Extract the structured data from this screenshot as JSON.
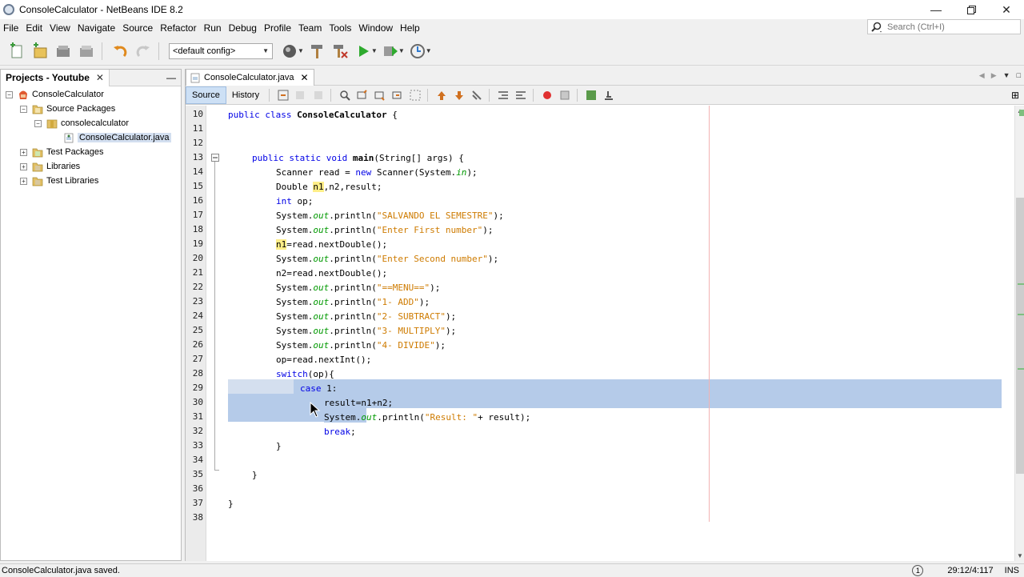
{
  "window": {
    "title": "ConsoleCalculator - NetBeans IDE 8.2",
    "controls": [
      "minimize",
      "restore",
      "close"
    ]
  },
  "menu": [
    "File",
    "Edit",
    "View",
    "Navigate",
    "Source",
    "Refactor",
    "Run",
    "Debug",
    "Profile",
    "Team",
    "Tools",
    "Window",
    "Help"
  ],
  "search": {
    "placeholder": "Search (Ctrl+I)"
  },
  "toolbar": {
    "config_value": "<default config>",
    "icons": [
      "new-file-icon",
      "new-project-icon",
      "open-project-icon",
      "close-project-icon",
      "undo-icon",
      "redo-icon",
      "globe-icon",
      "hammer-icon",
      "clean-build-icon",
      "run-icon",
      "debug-icon",
      "profile-icon"
    ]
  },
  "projects_panel": {
    "tab_label": "Projects - Youtube",
    "tree": [
      {
        "label": "ConsoleCalculator",
        "icon": "project-icon",
        "toggle": "−",
        "level": 0
      },
      {
        "label": "Source Packages",
        "icon": "folder-icon",
        "toggle": "−",
        "level": 1
      },
      {
        "label": "consolecalculator",
        "icon": "package-icon",
        "toggle": "−",
        "level": 2
      },
      {
        "label": "ConsoleCalculator.java",
        "icon": "java-file-icon",
        "toggle": "",
        "level": 3
      },
      {
        "label": "Test Packages",
        "icon": "folder-icon",
        "toggle": "+",
        "level": 1
      },
      {
        "label": "Libraries",
        "icon": "folder-icon",
        "toggle": "+",
        "level": 1
      },
      {
        "label": "Test Libraries",
        "icon": "folder-icon",
        "toggle": "+",
        "level": 1
      }
    ]
  },
  "editor": {
    "file_tab": "ConsoleCalculator.java",
    "modes": [
      "Source",
      "History"
    ],
    "active_mode": "Source",
    "line_numbers": [
      "10",
      "11",
      "12",
      "13",
      "14",
      "15",
      "16",
      "17",
      "18",
      "19",
      "20",
      "21",
      "22",
      "23",
      "24",
      "25",
      "26",
      "27",
      "28",
      "29",
      "30",
      "31",
      "32",
      "33",
      "34",
      "35",
      "36",
      "37",
      "38"
    ],
    "code": {
      "l10": {
        "kw": "public class ",
        "name": "ConsoleCalculator",
        "rest": " {"
      },
      "l13": {
        "kw": "public static void ",
        "name": "main",
        "rest": "(String[] args) {"
      },
      "l14": {
        "a": "Scanner read = ",
        "kw": "new",
        "b": " Scanner(System.",
        "fld": "in",
        "c": ");"
      },
      "l15": {
        "a": "Double ",
        "var": "n1",
        "b": ",n2,result;"
      },
      "l16": {
        "kw": "int",
        "a": " op;"
      },
      "l17": {
        "a": "System.",
        "fld": "out",
        "b": ".println(",
        "str": "\"SALVANDO EL SEMESTRE\"",
        "c": ");"
      },
      "l18": {
        "a": "System.",
        "fld": "out",
        "b": ".println(",
        "str": "\"Enter First number\"",
        "c": ");"
      },
      "l19": {
        "var": "n1",
        "a": "=read.nextDouble();"
      },
      "l20": {
        "a": "System.",
        "fld": "out",
        "b": ".println(",
        "str": "\"Enter Second number\"",
        "c": ");"
      },
      "l21": {
        "a": "n2=read.nextDouble();"
      },
      "l22": {
        "a": "System.",
        "fld": "out",
        "b": ".println(",
        "str": "\"==MENU==\"",
        "c": ");"
      },
      "l23": {
        "a": "System.",
        "fld": "out",
        "b": ".println(",
        "str": "\"1- ADD\"",
        "c": ");"
      },
      "l24": {
        "a": "System.",
        "fld": "out",
        "b": ".println(",
        "str": "\"2- SUBTRACT\"",
        "c": ");"
      },
      "l25": {
        "a": "System.",
        "fld": "out",
        "b": ".println(",
        "str": "\"3- MULTIPLY\"",
        "c": ");"
      },
      "l26": {
        "a": "System.",
        "fld": "out",
        "b": ".println(",
        "str": "\"4- DIVIDE\"",
        "c": ");"
      },
      "l27": {
        "a": "op=read.nextInt();"
      },
      "l28": {
        "kw": "switch",
        "a": "(op){"
      },
      "l29": {
        "kw": "case",
        "a": " 1:"
      },
      "l30": {
        "a": "result=n1+n2;"
      },
      "l31": {
        "a": "System.",
        "fld": "out",
        "b": ".println(",
        "str": "\"Result: \"",
        "c": "+ result);"
      },
      "l32": {
        "kw": "break",
        "a": ";"
      },
      "l33": {
        "a": "}"
      },
      "l35": {
        "a": "}"
      },
      "l37": {
        "a": "}"
      }
    }
  },
  "status": {
    "message": "ConsoleCalculator.java saved.",
    "position": "29:12/4:117",
    "mode": "INS",
    "notification_icon": "1"
  },
  "colors": {
    "keyword": "#0000e6",
    "string": "#ce7b00",
    "field": "#009900",
    "selection": "#b5cbe9",
    "margin_line": "#f2b3b3"
  }
}
